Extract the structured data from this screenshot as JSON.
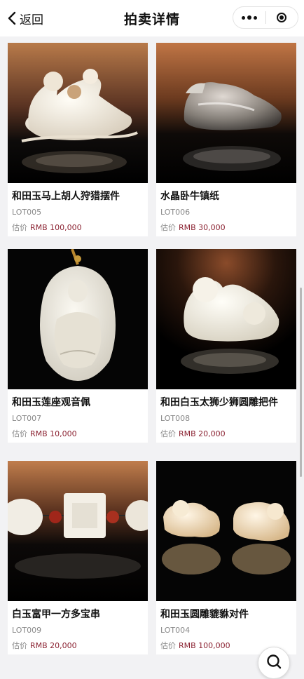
{
  "header": {
    "back_label": "返回",
    "title": "拍卖详情"
  },
  "items": [
    {
      "name": "和田玉马上胡人狩猎摆件",
      "lot": "LOT005",
      "estimate_label": "估价",
      "estimate": "RMB 100,000"
    },
    {
      "name": "水晶卧牛镇纸",
      "lot": "LOT006",
      "estimate_label": "估价",
      "estimate": "RMB 30,000"
    },
    {
      "name": "和田玉莲座观音佩",
      "lot": "LOT007",
      "estimate_label": "估价",
      "estimate": "RMB 10,000"
    },
    {
      "name": "和田白玉太狮少狮圆雕把件",
      "lot": "LOT008",
      "estimate_label": "估价",
      "estimate": "RMB 20,000"
    },
    {
      "name": "白玉富甲一方多宝串",
      "lot": "LOT009",
      "estimate_label": "估价",
      "estimate": "RMB 20,000"
    },
    {
      "name": "和田玉圆雕貔貅对件",
      "lot": "LOT004",
      "estimate_label": "估价",
      "estimate": "RMB 100,000"
    }
  ],
  "colors": {
    "price": "#8b2332",
    "muted": "#888888"
  }
}
